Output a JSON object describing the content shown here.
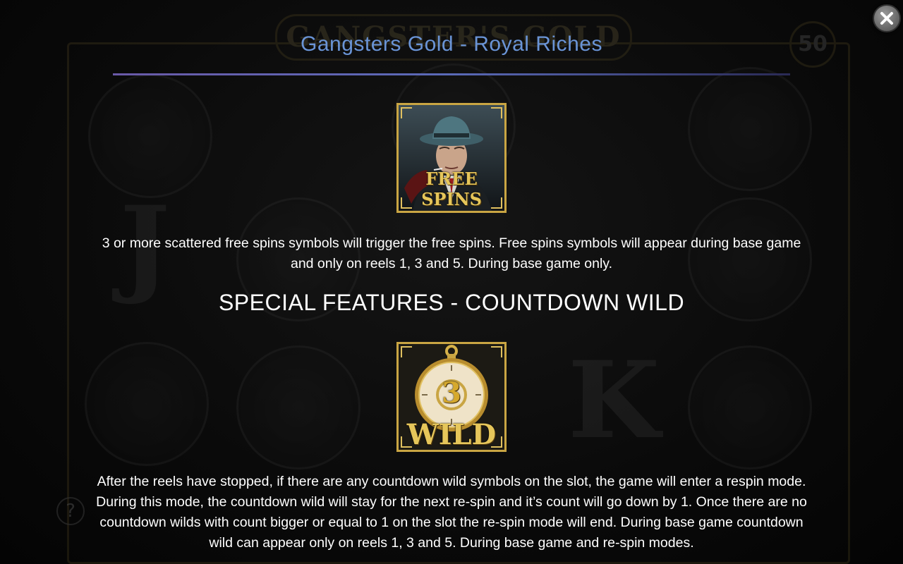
{
  "background": {
    "logo_text": "GANGSTER'S GOLD",
    "badge_value": "50",
    "reel_letters": [
      "J",
      "J",
      "K"
    ],
    "wild_label": "WILD",
    "free_spins_label": "FREE SPINS",
    "help_icon": "?"
  },
  "header": {
    "title": "Gangsters Gold - Royal Riches",
    "close_icon": "close-icon"
  },
  "sections": {
    "free_spins": {
      "symbol_label": "FREE SPINS",
      "description": "3 or more scattered free spins symbols will trigger the free spins. Free spins symbols will appear during base game and only on reels 1, 3 and 5. During base game only."
    },
    "countdown_wild": {
      "heading": "SPECIAL FEATURES - COUNTDOWN WILD",
      "symbol_label": "WILD",
      "symbol_count": "3",
      "description": "After the reels have stopped, if there are any countdown wild symbols on the slot, the game will enter a respin mode. During this mode, the countdown wild will stay for the next re-spin and it’s count will go down by 1. Once there are no countdown wilds with count bigger or equal to 1 on the slot the re-spin mode will end. During base game countdown wild can appear only on reels 1, 3 and 5. During base game and re-spin modes."
    }
  },
  "colors": {
    "title": "#6a94d6",
    "gold": "#c9a543",
    "text": "#ffffff"
  }
}
